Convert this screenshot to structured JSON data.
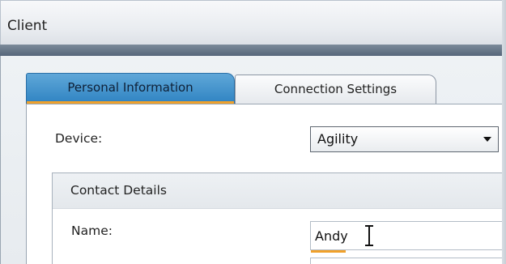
{
  "window": {
    "title": "Client"
  },
  "tabs": [
    {
      "label": "Personal Information",
      "active": true
    },
    {
      "label": "Connection Settings",
      "active": false
    }
  ],
  "device": {
    "label": "Device:",
    "selected": "Agility"
  },
  "contact_details": {
    "title": "Contact Details",
    "name_label": "Name:",
    "name_value": "Andy"
  },
  "colors": {
    "active_tab": "#2f83c2",
    "accent": "#f0a12b",
    "title_strip": "#5d6d80"
  },
  "icons": {
    "dropdown": "chevron-down-icon",
    "cursor": "text-cursor-icon"
  }
}
